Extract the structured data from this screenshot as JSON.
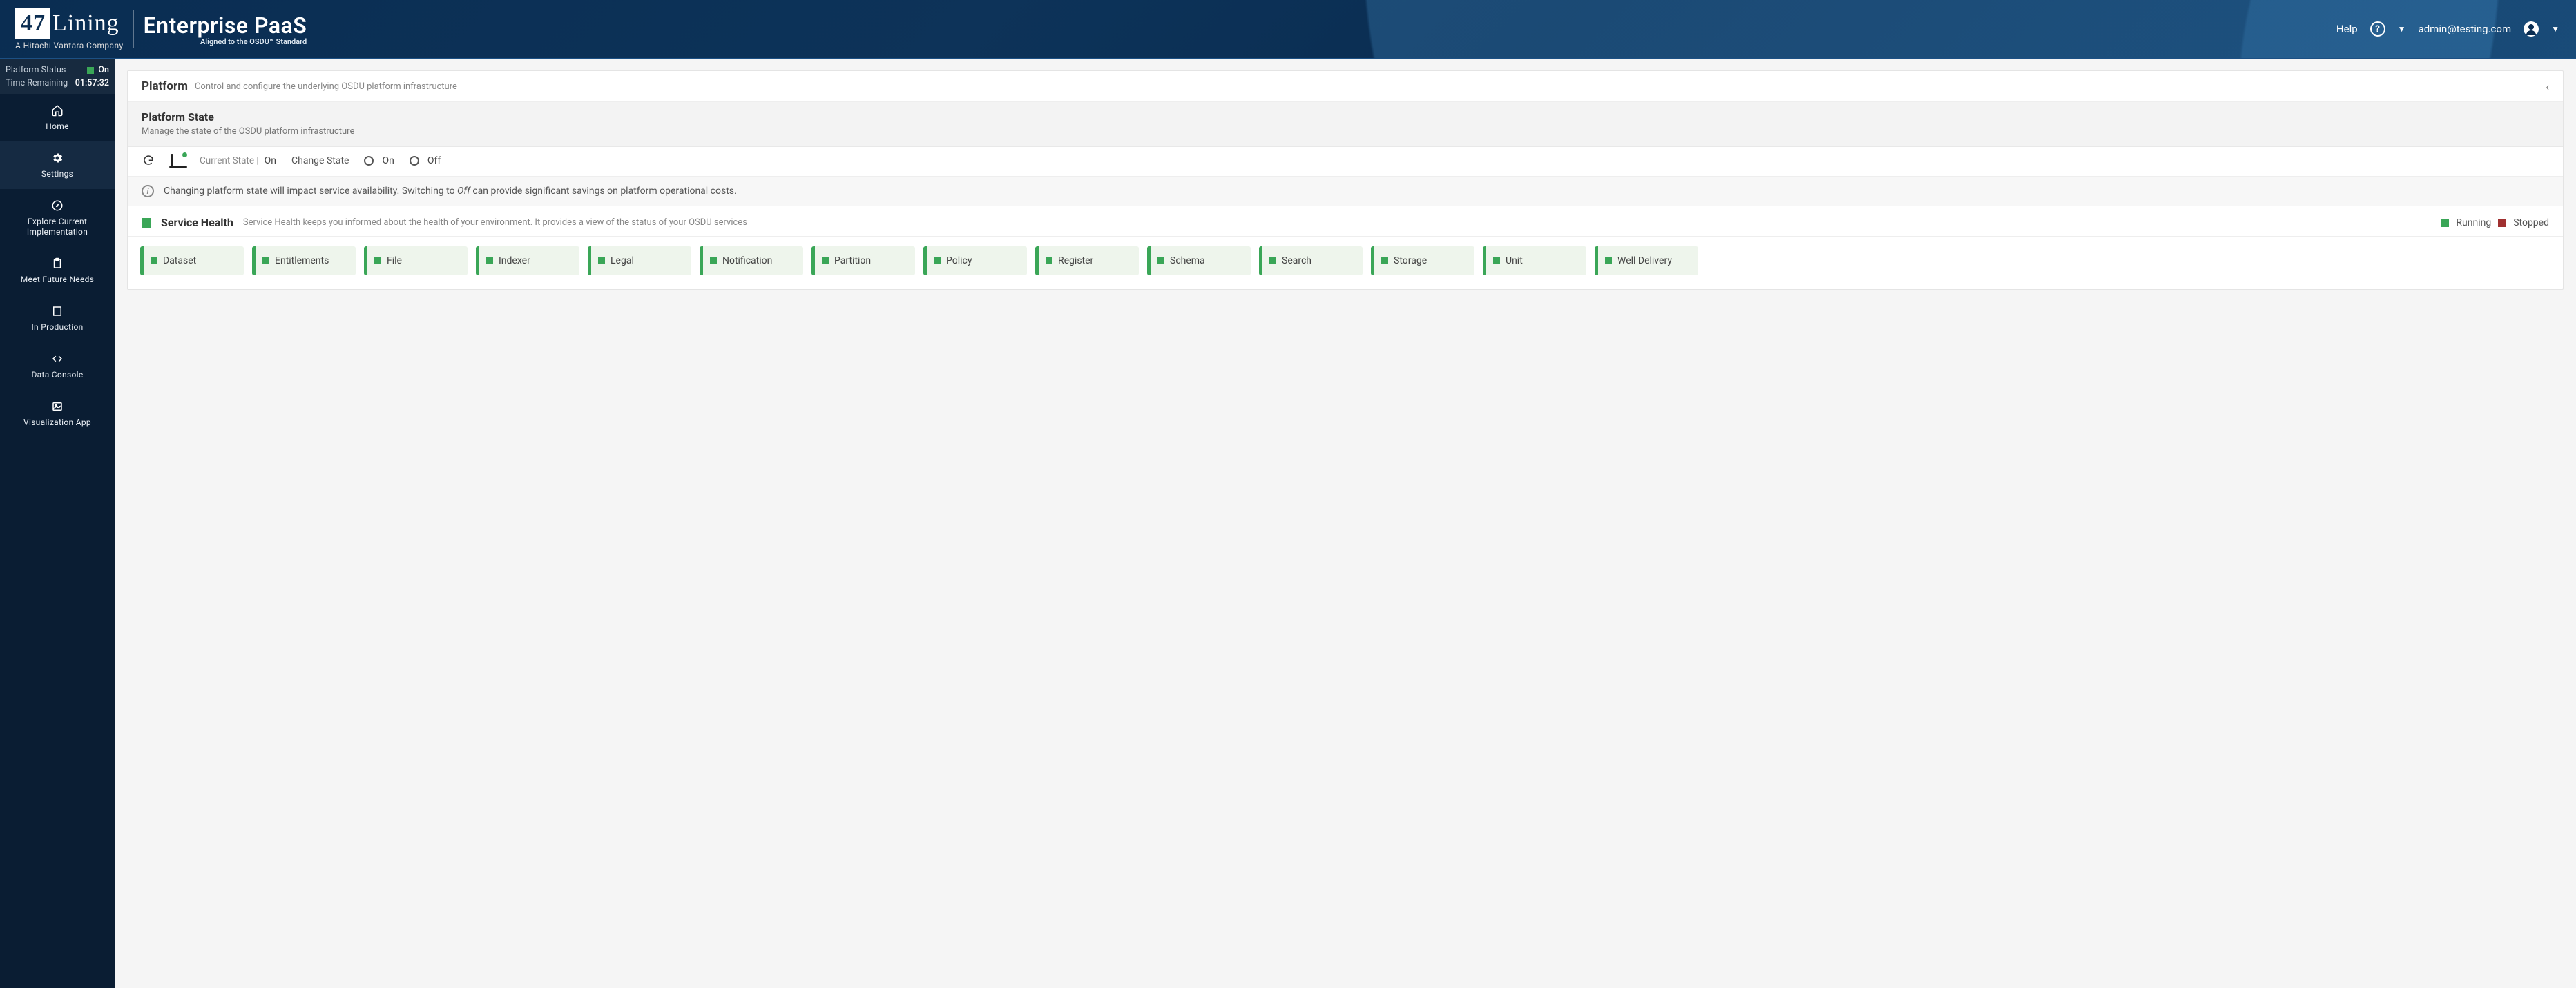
{
  "header": {
    "logo_47": "47",
    "logo_lining": "Lining",
    "logo_sub": "A Hitachi Vantara Company",
    "product_title": "Enterprise PaaS",
    "product_sub": "Aligned to the OSDU™ Standard",
    "help_label": "Help",
    "user_email": "admin@testing.com"
  },
  "sidebar": {
    "status": {
      "platform_label": "Platform Status",
      "platform_value": "On",
      "time_label": "Time Remaining",
      "time_value": "01:57:32"
    },
    "items": [
      {
        "label": "Home"
      },
      {
        "label": "Settings"
      },
      {
        "label": "Explore Current Implementation"
      },
      {
        "label": "Meet Future Needs"
      },
      {
        "label": "In Production"
      },
      {
        "label": "Data Console"
      },
      {
        "label": "Visualization App"
      }
    ]
  },
  "panel": {
    "title": "Platform",
    "subtitle": "Control and configure the underlying OSDU platform infrastructure"
  },
  "platform_state": {
    "title": "Platform State",
    "subtitle": "Manage the state of the OSDU platform infrastructure",
    "current_state_label": "Current State |",
    "current_state_value": "On",
    "change_state_label": "Change State",
    "radio_on": "On",
    "radio_off": "Off",
    "info_prefix": "Changing platform state will impact service availability. Switching to ",
    "info_off": "Off",
    "info_suffix": " can provide significant savings on platform operational costs."
  },
  "service_health": {
    "title": "Service Health",
    "desc": "Service Health keeps you informed about the health of your environment. It provides a view of the status of your OSDU services",
    "legend_running": "Running",
    "legend_stopped": "Stopped",
    "services": [
      {
        "name": "Dataset",
        "status": "running"
      },
      {
        "name": "Entitlements",
        "status": "running"
      },
      {
        "name": "File",
        "status": "running"
      },
      {
        "name": "Indexer",
        "status": "running"
      },
      {
        "name": "Legal",
        "status": "running"
      },
      {
        "name": "Notification",
        "status": "running"
      },
      {
        "name": "Partition",
        "status": "running"
      },
      {
        "name": "Policy",
        "status": "running"
      },
      {
        "name": "Register",
        "status": "running"
      },
      {
        "name": "Schema",
        "status": "running"
      },
      {
        "name": "Search",
        "status": "running"
      },
      {
        "name": "Storage",
        "status": "running"
      },
      {
        "name": "Unit",
        "status": "running"
      },
      {
        "name": "Well Delivery",
        "status": "running"
      }
    ]
  },
  "colors": {
    "running": "#3aa657",
    "stopped": "#a03030"
  }
}
